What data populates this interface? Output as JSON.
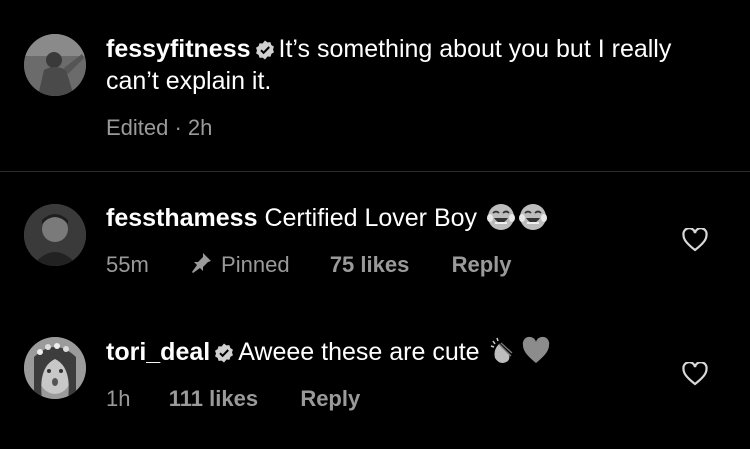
{
  "comments": [
    {
      "username": "fessyfitness",
      "verified": true,
      "text": "It’s something about you but I really can’t explain it.",
      "meta": "Edited · 2h",
      "avatar_icon": "profile-photo"
    },
    {
      "username": "fessthamess",
      "verified": false,
      "text": "Certified Lover Boy",
      "emojis": [
        "tears-of-joy-emoji",
        "tears-of-joy-emoji"
      ],
      "time": "55m",
      "pinned_label": "Pinned",
      "likes": "75 likes",
      "reply_label": "Reply",
      "avatar_icon": "profile-photo"
    },
    {
      "username": "tori_deal",
      "verified": true,
      "text": "Aweee these are cute",
      "emojis": [
        "clapping-hands-emoji",
        "heart-emoji"
      ],
      "time": "1h",
      "likes": "111 likes",
      "reply_label": "Reply",
      "avatar_icon": "profile-photo"
    }
  ],
  "colors": {
    "background": "#000000",
    "text": "#ffffff",
    "meta": "#9a9a9a"
  }
}
